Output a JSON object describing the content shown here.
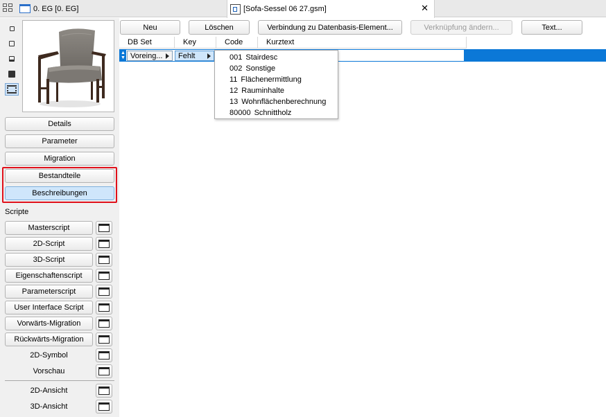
{
  "tabs": {
    "plan_tab_label": "0. EG [0. EG]",
    "active_tab_label": "[Sofa-Sessel 06 27.gsm]",
    "close_glyph": "✕"
  },
  "left_panel": {
    "view_icons": [
      "2d-symbol-icon",
      "2d-outline-icon",
      "object-outline-icon",
      "3d-cube-icon",
      "film-strip-icon"
    ],
    "buttons": {
      "details": "Details",
      "parameter": "Parameter",
      "migration": "Migration",
      "bestandteile": "Bestandteile",
      "beschreibungen": "Beschreibungen"
    },
    "scripts_heading": "Scripte",
    "scripts": {
      "master": "Masterscript",
      "s2d": "2D-Script",
      "s3d": "3D-Script",
      "eigenschaften": "Eigenschaftenscript",
      "parameterscript": "Parameterscript",
      "ui": "User Interface Script",
      "vorwaerts": "Vorwärts-Migration",
      "rueckwaerts": "Rückwärts-Migration",
      "symbol2d": "2D-Symbol",
      "vorschau": "Vorschau",
      "ansicht2d": "2D-Ansicht",
      "ansicht3d": "3D-Ansicht"
    }
  },
  "toolbar": {
    "neu": "Neu",
    "loeschen": "Löschen",
    "verbindung": "Verbindung zu Datenbasis-Element...",
    "verknuepfung": "Verknüpfung ändern...",
    "text": "Text..."
  },
  "table": {
    "columns": {
      "dbset": "DB Set",
      "key": "Key",
      "code": "Code",
      "kurztext": "Kurztext"
    },
    "selected_row": {
      "dbset": "Voreing...",
      "key": "Fehlt"
    }
  },
  "dropdown": {
    "items": [
      {
        "code": "001",
        "label": "Stairdesc"
      },
      {
        "code": "002",
        "label": "Sonstige"
      },
      {
        "code": "11",
        "label": "Flächenermittlung"
      },
      {
        "code": "12",
        "label": "Rauminhalte"
      },
      {
        "code": "13",
        "label": "Wohnflächenberechnung"
      },
      {
        "code": "80000",
        "label": "Schnittholz"
      }
    ]
  },
  "colors": {
    "selection_blue": "#0b78d7",
    "highlight_red": "#e0101a",
    "selected_button": "#cfe6fb"
  }
}
